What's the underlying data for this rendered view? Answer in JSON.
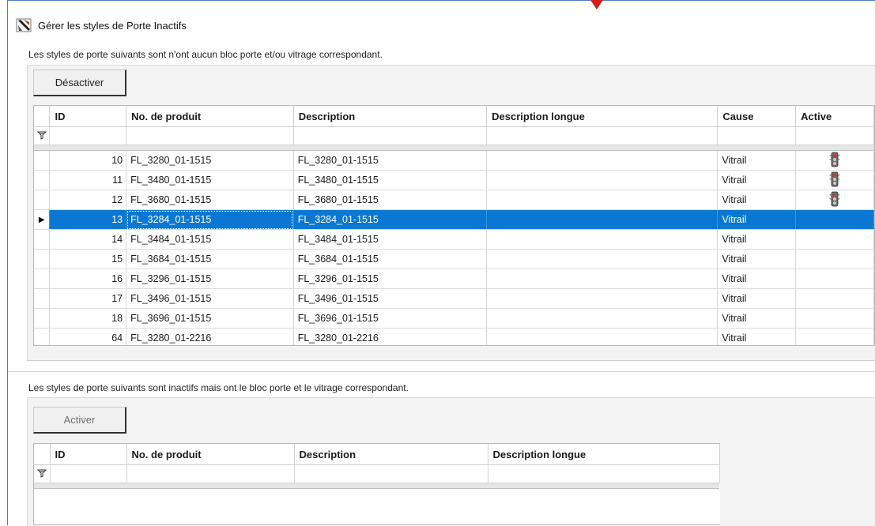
{
  "window": {
    "title": "Gérer les styles de Porte Inactifs",
    "accent_color": "#0a77d3",
    "marker_color": "#d71c1c"
  },
  "section1": {
    "label": "Les styles de porte suivants sont n'ont aucun bloc porte et/ou vitrage correspondant.",
    "button_label": "Désactiver",
    "columns": [
      "ID",
      "No. de produit",
      "Description",
      "Description longue",
      "Cause",
      "Active"
    ],
    "rows": [
      {
        "id": "10",
        "product": "FL_3280_01-1515",
        "description": "FL_3280_01-1515",
        "long_description": "",
        "cause": "Vitrail",
        "active_icon": "traffic-light-icon"
      },
      {
        "id": "11",
        "product": "FL_3480_01-1515",
        "description": "FL_3480_01-1515",
        "long_description": "",
        "cause": "Vitrail",
        "active_icon": "traffic-light-icon"
      },
      {
        "id": "12",
        "product": "FL_3680_01-1515",
        "description": "FL_3680_01-1515",
        "long_description": "",
        "cause": "Vitrail",
        "active_icon": "traffic-light-icon"
      },
      {
        "id": "13",
        "product": "FL_3284_01-1515",
        "description": "FL_3284_01-1515",
        "long_description": "",
        "cause": "Vitrail",
        "active_icon": "",
        "selected": true
      },
      {
        "id": "14",
        "product": "FL_3484_01-1515",
        "description": "FL_3484_01-1515",
        "long_description": "",
        "cause": "Vitrail",
        "active_icon": ""
      },
      {
        "id": "15",
        "product": "FL_3684_01-1515",
        "description": "FL_3684_01-1515",
        "long_description": "",
        "cause": "Vitrail",
        "active_icon": ""
      },
      {
        "id": "16",
        "product": "FL_3296_01-1515",
        "description": "FL_3296_01-1515",
        "long_description": "",
        "cause": "Vitrail",
        "active_icon": ""
      },
      {
        "id": "17",
        "product": "FL_3496_01-1515",
        "description": "FL_3496_01-1515",
        "long_description": "",
        "cause": "Vitrail",
        "active_icon": ""
      },
      {
        "id": "18",
        "product": "FL_3696_01-1515",
        "description": "FL_3696_01-1515",
        "long_description": "",
        "cause": "Vitrail",
        "active_icon": ""
      },
      {
        "id": "64",
        "product": "FL_3280_01-2216",
        "description": "FL_3280_01-2216",
        "long_description": "",
        "cause": "Vitrail",
        "active_icon": ""
      }
    ]
  },
  "section2": {
    "label": "Les styles de porte suivants sont inactifs mais ont le bloc porte et le vitrage correspondant.",
    "button_label": "Activer",
    "columns": [
      "ID",
      "No. de produit",
      "Description",
      "Description longue"
    ],
    "rows": []
  }
}
